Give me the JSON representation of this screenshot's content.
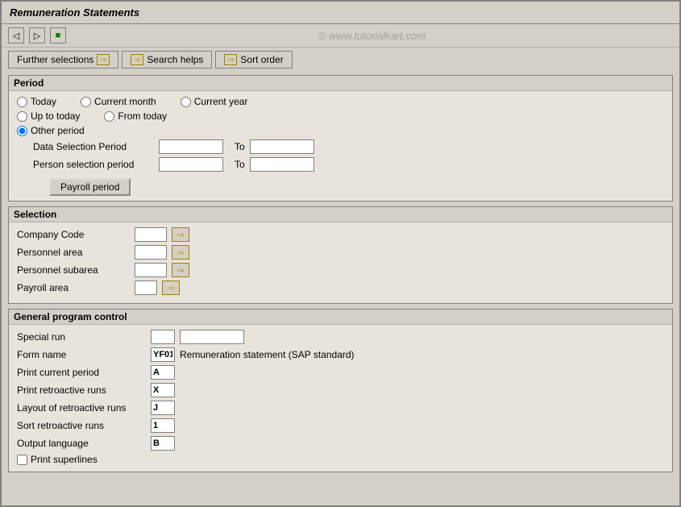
{
  "window": {
    "title": "Remuneration Statements"
  },
  "toolbar": {
    "icons": [
      "back",
      "forward",
      "save"
    ]
  },
  "watermark": "© www.tutorialkart.com",
  "tabs": [
    {
      "label": "Further selections",
      "has_arrow": true
    },
    {
      "label": "Search helps",
      "has_arrow": true
    },
    {
      "label": "Sort order",
      "has_arrow": false
    }
  ],
  "period_section": {
    "title": "Period",
    "options": [
      {
        "label": "Today",
        "name": "period",
        "value": "today"
      },
      {
        "label": "Current month",
        "name": "period",
        "value": "current_month"
      },
      {
        "label": "Current year",
        "name": "period",
        "value": "current_year"
      },
      {
        "label": "Up to today",
        "name": "period",
        "value": "up_to_today"
      },
      {
        "label": "From today",
        "name": "period",
        "value": "from_today"
      },
      {
        "label": "Other period",
        "name": "period",
        "value": "other_period",
        "checked": true
      }
    ],
    "fields": [
      {
        "label": "Data Selection Period",
        "to_label": "To"
      },
      {
        "label": "Person selection period",
        "to_label": "To"
      }
    ],
    "payroll_button": "Payroll period"
  },
  "selection_section": {
    "title": "Selection",
    "rows": [
      {
        "label": "Company Code"
      },
      {
        "label": "Personnel area"
      },
      {
        "label": "Personnel subarea"
      },
      {
        "label": "Payroll area"
      }
    ]
  },
  "general_program_section": {
    "title": "General program control",
    "rows": [
      {
        "label": "Special run",
        "input1": "",
        "input2": ""
      },
      {
        "label": "Form name",
        "value": "YF01",
        "description": "Remuneration statement (SAP standard)"
      },
      {
        "label": "Print current period",
        "value": "A"
      },
      {
        "label": "Print retroactive runs",
        "value": "X"
      },
      {
        "label": "Layout of retroactive runs",
        "value": "J"
      },
      {
        "label": "Sort retroactive runs",
        "value": "1"
      },
      {
        "label": "Output language",
        "value": "B"
      }
    ],
    "checkbox_row": {
      "label": "Print superlines"
    }
  }
}
